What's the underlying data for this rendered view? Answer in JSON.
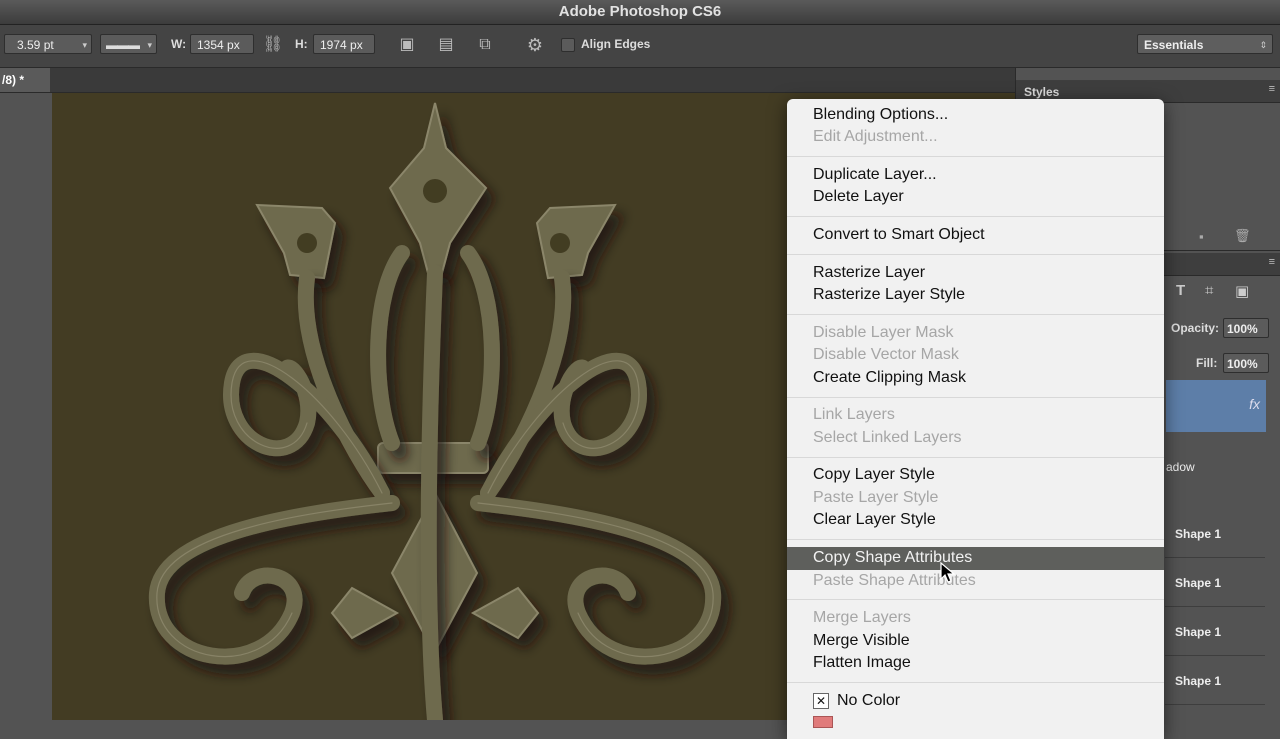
{
  "app": {
    "title": "Adobe Photoshop CS6"
  },
  "options_bar": {
    "stroke_width": "3.59 pt",
    "width_label": "W:",
    "width_value": "1354 px",
    "height_label": "H:",
    "height_value": "1974 px",
    "align_edges_label": "Align Edges",
    "workspace": "Essentials"
  },
  "document": {
    "tab_label": "/8) *"
  },
  "panels": {
    "styles_title": "Styles",
    "opacity_label": "Opacity:",
    "opacity_value": "100%",
    "fill_label": "Fill:",
    "fill_value": "100%",
    "effect_label": "adow",
    "layers": [
      "Shape 1",
      "Shape 1",
      "Shape 1",
      "Shape 1"
    ]
  },
  "context_menu": {
    "groups": [
      [
        {
          "label": "Blending Options...",
          "enabled": true
        },
        {
          "label": "Edit Adjustment...",
          "enabled": false
        }
      ],
      [
        {
          "label": "Duplicate Layer...",
          "enabled": true
        },
        {
          "label": "Delete Layer",
          "enabled": true
        }
      ],
      [
        {
          "label": "Convert to Smart Object",
          "enabled": true
        }
      ],
      [
        {
          "label": "Rasterize Layer",
          "enabled": true
        },
        {
          "label": "Rasterize Layer Style",
          "enabled": true
        }
      ],
      [
        {
          "label": "Disable Layer Mask",
          "enabled": false
        },
        {
          "label": "Disable Vector Mask",
          "enabled": false
        },
        {
          "label": "Create Clipping Mask",
          "enabled": true
        }
      ],
      [
        {
          "label": "Link Layers",
          "enabled": false
        },
        {
          "label": "Select Linked Layers",
          "enabled": false
        }
      ],
      [
        {
          "label": "Copy Layer Style",
          "enabled": true
        },
        {
          "label": "Paste Layer Style",
          "enabled": false
        },
        {
          "label": "Clear Layer Style",
          "enabled": true
        }
      ],
      [
        {
          "label": "Copy Shape Attributes",
          "enabled": true,
          "highlighted": true
        },
        {
          "label": "Paste Shape Attributes",
          "enabled": false
        }
      ],
      [
        {
          "label": "Merge Layers",
          "enabled": false
        },
        {
          "label": "Merge Visible",
          "enabled": true
        },
        {
          "label": "Flatten Image",
          "enabled": true
        }
      ],
      [
        {
          "label": "No Color",
          "enabled": true,
          "checked": true
        }
      ]
    ]
  },
  "colors": {
    "canvas_bg": "#433c23",
    "ornament": "#6e6a4e",
    "menu_highlight": "#5e5f5c",
    "red_swatch": "#e07b7b"
  }
}
